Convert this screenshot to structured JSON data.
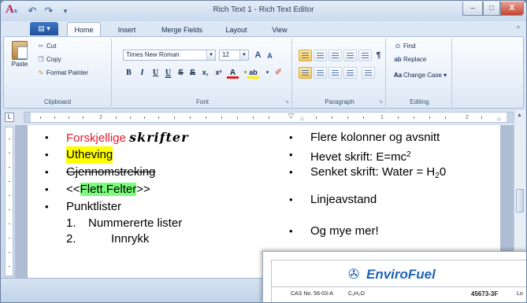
{
  "window": {
    "title": "Rich Text 1 - Rich Text Editor",
    "app_icon": "A",
    "app_icon_sup": "x",
    "controls": {
      "minimize": "–",
      "maximize": "□",
      "close": "X"
    }
  },
  "quick_access": {
    "undo": "↶",
    "redo": "↷",
    "more": "▾"
  },
  "tabs": {
    "file": "▤ ▾",
    "items": [
      "Home",
      "Insert",
      "Merge Fields",
      "Layout",
      "View"
    ],
    "active": "Home",
    "collapse": "^"
  },
  "ribbon": {
    "clipboard": {
      "label": "Clipboard",
      "paste": "Paste",
      "cut": "Cut",
      "copy": "Copy",
      "format_painter": "Format Painter"
    },
    "font": {
      "label": "Font",
      "font_name": "Times New Roman",
      "font_size": "12",
      "grow": "A",
      "shrink": "A",
      "bold": "B",
      "italic": "I",
      "underline": "U",
      "double_underline": "U",
      "strikethrough": "S",
      "double_strike": "S",
      "subscript": "x,",
      "superscript": "x²",
      "font_color": "A",
      "highlight": "ab"
    },
    "paragraph": {
      "label": "Paragraph"
    },
    "editing": {
      "label": "Editing",
      "find": "Find",
      "replace": "Replace",
      "change_case": "Change Case ▾"
    }
  },
  "ruler": {
    "left_labels": [
      "2"
    ],
    "right_labels": [
      "1",
      "2"
    ]
  },
  "document": {
    "left_column": {
      "forskjellige": "Forskjellige",
      "skrifter": "skrifter",
      "utheving": "Utheving",
      "gjennomstreking": "Gjennomstreking",
      "merge_open": "<<",
      "merge_field": "Flett.Felter",
      "merge_close": ">>",
      "punktlister": "Punktlister",
      "numbered_1_num": "1.",
      "numbered_1_text": "Nummererte lister",
      "numbered_2_num": "2.",
      "numbered_2_text": "Innrykk"
    },
    "right_column": {
      "kolonner": "Flere kolonner og avsnitt",
      "hevet_prefix": "Hevet skrift: E=mc",
      "hevet_sup": "2",
      "senket_prefix": "Senket skrift: Water = H",
      "senket_sub": "2",
      "senket_suffix": "0",
      "linjeavstand": "Linjeavstand",
      "mer": "Og mye mer!"
    },
    "bullet": "•"
  },
  "label_overlay": {
    "brand_first": "Enviro",
    "brand_second": "Fuel",
    "cas": "CAS No. 56-03-A",
    "formula": "C₂H₂O",
    "product_no": "45673-3F",
    "lot": "Lo"
  }
}
